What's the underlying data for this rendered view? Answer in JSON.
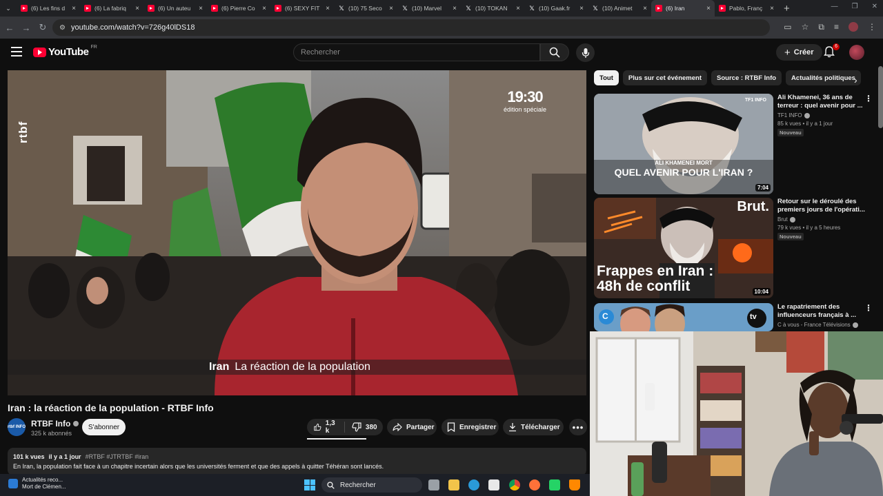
{
  "browser": {
    "tabs": [
      {
        "title": "(6) Les fins d",
        "icon": "youtube-icon"
      },
      {
        "title": "(6) La fabriq",
        "icon": "youtube-icon"
      },
      {
        "title": "(6) Un auteu",
        "icon": "youtube-icon"
      },
      {
        "title": "(6) Pierre Co",
        "icon": "youtube-icon"
      },
      {
        "title": "(6) SEXY FIT",
        "icon": "youtube-icon"
      },
      {
        "title": "(10) 75 Seco",
        "icon": "x-icon"
      },
      {
        "title": "(10) Marvel",
        "icon": "x-icon"
      },
      {
        "title": "(10) TOKAN",
        "icon": "x-icon"
      },
      {
        "title": "(10) Gaak.fr",
        "icon": "x-icon"
      },
      {
        "title": "(10) Animet",
        "icon": "x-icon"
      },
      {
        "title": "(6) Iran",
        "icon": "youtube-icon",
        "active": true
      },
      {
        "title": "Pablo, Franç",
        "icon": "youtube-icon"
      }
    ],
    "url": "youtube.com/watch?v=726g40lDS18"
  },
  "youtube": {
    "logo_text": "YouTube",
    "region": "FR",
    "search_placeholder": "Rechercher",
    "create_label": "Créer",
    "notif_count": "6"
  },
  "video": {
    "overlay_channel": "rtbf",
    "overlay_edition_time": "19:30",
    "overlay_edition_label": "édition spéciale",
    "lower_third_keyword": "Iran",
    "lower_third_text": "La réaction de la population",
    "title": "Iran : la réaction de la population - RTBF Info",
    "channel_name": "RTBF Info",
    "channel_avatar_text": "rtbf INFO",
    "subscribers": "325 k abonnés",
    "subscribe_label": "S'abonner",
    "likes": "1,3 k",
    "dislikes": "380",
    "share_label": "Partager",
    "save_label": "Enregistrer",
    "download_label": "Télécharger",
    "views": "101 k vues",
    "age": "il y a 1 jour",
    "tags": "#RTBF #JTRTBF #iran",
    "description": "En Iran, la population fait face à un chapitre incertain alors que les universités ferment et que des appels à quitter Téhéran sont lancés."
  },
  "chips": [
    "Tout",
    "Plus sur cet événement",
    "Source : RTBF Info",
    "Actualités politiques"
  ],
  "recommendations": [
    {
      "title": "Ali Khamenei, 36 ans de terreur : quel avenir pour ...",
      "channel": "TF1 INFO",
      "stats": "85 k vues • il y a 1 jour",
      "badge": "Nouveau",
      "duration": "7:04",
      "thumb_caption_small": "ALI KHAMENEI MORT",
      "thumb_caption_big": "QUEL AVENIR POUR L'IRAN ?",
      "thumb_logo": "TF1 INFO"
    },
    {
      "title": "Retour sur le déroulé des premiers jours de l'opérati...",
      "channel": "Brut",
      "stats": "79 k vues • il y a 5 heures",
      "badge": "Nouveau",
      "duration": "10:04",
      "thumb_caption_big": "Frappes en Iran :",
      "thumb_caption_big2": "48h de conflit",
      "thumb_logo": "Brut."
    },
    {
      "title": "Le rapatriement des influenceurs français à ...",
      "channel": "C à vous - France Télévisions",
      "thumb_logo": "tv"
    }
  ],
  "taskbar": {
    "news_line1": "Actualités reco...",
    "news_line2": "Mort de Clémen...",
    "search_label": "Rechercher"
  },
  "colors": {
    "youtube_red": "#ff0033",
    "background": "#0f0f0f",
    "chip_bg": "#272727"
  }
}
